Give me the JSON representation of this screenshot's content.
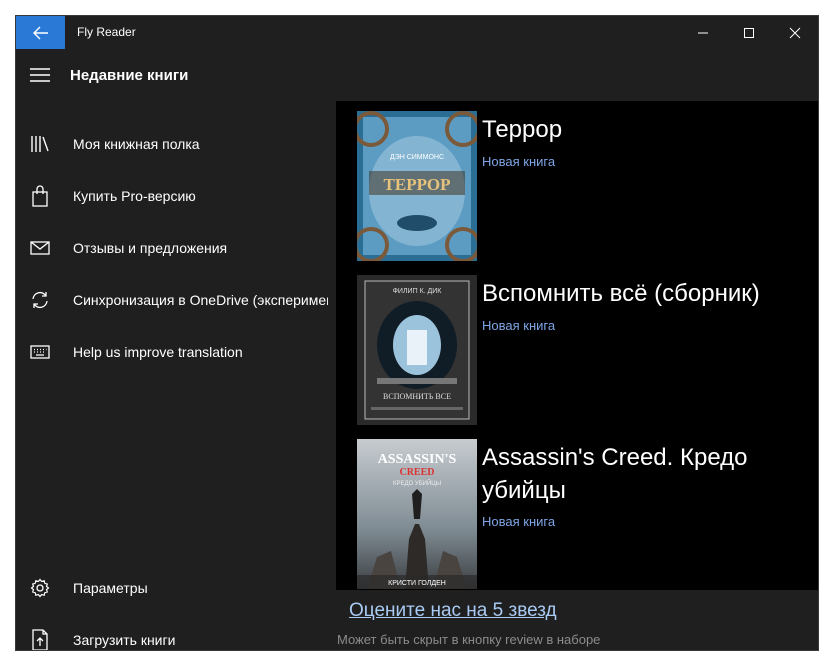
{
  "window": {
    "title": "Fly Reader",
    "back_icon": "arrow-left-icon",
    "controls": [
      "minimize-icon",
      "maximize-icon",
      "close-icon"
    ],
    "accent_color": "#2b79d6"
  },
  "sidebar": {
    "title": "Недавние книги",
    "menu_icon": "hamburger-icon",
    "items": [
      {
        "label": "Моя книжная полка",
        "icon": "library-icon"
      },
      {
        "label": "Купить Pro-версию",
        "icon": "shopping-bag-icon"
      },
      {
        "label": "Отзывы и предложения",
        "icon": "mail-icon"
      },
      {
        "label": "Синхронизация в OneDrive (экспериментально)",
        "icon": "sync-icon"
      },
      {
        "label": "Help us improve translation",
        "icon": "keyboard-icon"
      }
    ],
    "bottom_items": [
      {
        "label": "Параметры",
        "icon": "gear-icon"
      },
      {
        "label": "Загрузить книги",
        "icon": "upload-document-icon"
      }
    ]
  },
  "books": [
    {
      "title": "Террор",
      "status": "Новая книга",
      "cover": {
        "author": "ДЭН СИММОНС",
        "title": "ТЕРРОР",
        "colors": [
          "#2e6f96",
          "#8fbcd6"
        ]
      }
    },
    {
      "title": "Вспомнить всё (сборник)",
      "status": "Новая книга",
      "cover": {
        "author": "ФИЛИП К. ДИК",
        "title": "ВСПОМНИТЬ ВСЕ",
        "colors": [
          "#2a2a2a",
          "#8fb6d6"
        ]
      }
    },
    {
      "title": "Assassin's Creed. Кредо убийцы",
      "status": "Новая книга",
      "cover": {
        "author": "КРИСТИ ГОЛДЕН",
        "title": "ASSASSIN'S",
        "subtitle": "CREED",
        "tagline": "КРЕДО УБИЙЦЫ",
        "colors": [
          "#6f7d86",
          "#c9cdd0"
        ]
      }
    }
  ],
  "footer": {
    "rate_link": "Оцените нас на 5 звезд",
    "note": "Может быть скрыт в кнопку review в наборе"
  }
}
